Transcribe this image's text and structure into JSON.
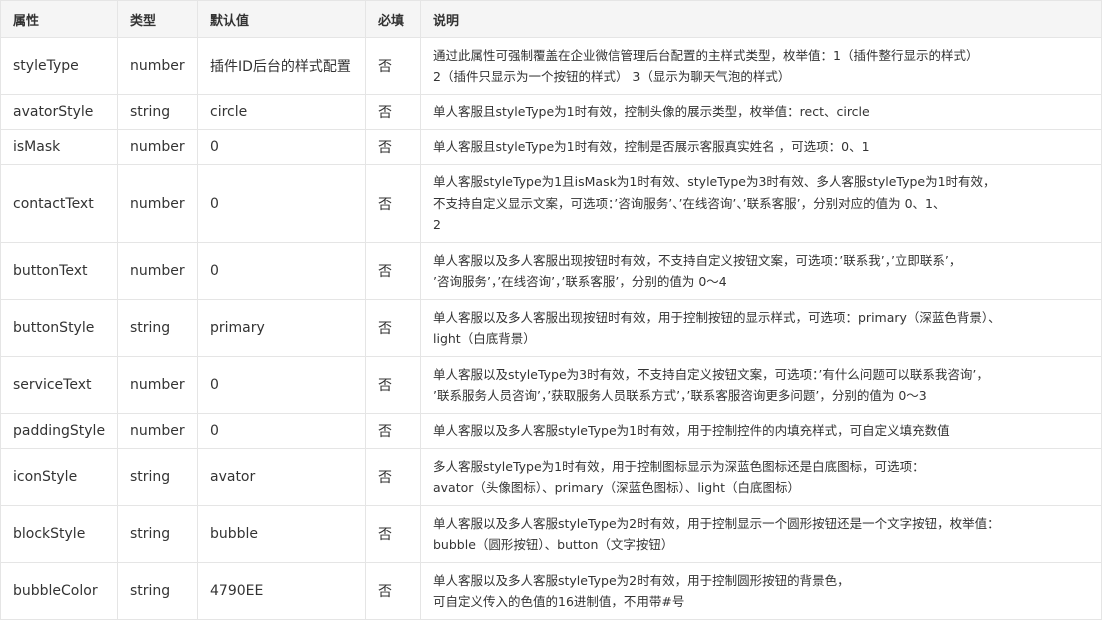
{
  "headers": {
    "attr": "属性",
    "type": "类型",
    "default": "默认值",
    "required": "必填",
    "desc": "说明"
  },
  "rows": [
    {
      "attr": "styleType",
      "type": "number",
      "default": "插件ID后台的样式配置",
      "required": "否",
      "desc": [
        "通过此属性可强制覆盖在企业微信管理后台配置的主样式类型，枚举值：1（插件整行显示的样式）",
        "2（插件只显示为一个按钮的样式）  3（显示为聊天气泡的样式）"
      ]
    },
    {
      "attr": "avatorStyle",
      "type": "string",
      "default": "circle",
      "required": "否",
      "desc": [
        "单人客服且styleType为1时有效，控制头像的展示类型，枚举值：rect、circle"
      ]
    },
    {
      "attr": "isMask",
      "type": "number",
      "default": "0",
      "required": "否",
      "desc": [
        "单人客服且styleType为1时有效，控制是否展示客服真实姓名 ，可选项：0、1"
      ]
    },
    {
      "attr": "contactText",
      "type": "number",
      "default": "0",
      "required": "否",
      "desc": [
        "单人客服styleType为1且isMask为1时有效、styleType为3时有效、多人客服styleType为1时有效，",
        "不支持自定义显示文案，可选项：’咨询服务’、’在线咨询’、’联系客服’，分别对应的值为 0、1、",
        "2"
      ]
    },
    {
      "attr": "buttonText",
      "type": "number",
      "default": "0",
      "required": "否",
      "desc": [
        "单人客服以及多人客服出现按钮时有效，不支持自定义按钮文案，可选项：’联系我’，’立即联系’，",
        "’咨询服务’，’在线咨询’，’联系客服’，分别的值为 0～4"
      ]
    },
    {
      "attr": "buttonStyle",
      "type": "string",
      "default": "primary",
      "required": "否",
      "desc": [
        "单人客服以及多人客服出现按钮时有效，用于控制按钮的显示样式，可选项：primary（深蓝色背景）、",
        "light（白底背景）"
      ]
    },
    {
      "attr": "serviceText",
      "type": "number",
      "default": "0",
      "required": "否",
      "desc": [
        "单人客服以及styleType为3时有效，不支持自定义按钮文案，可选项：’有什么问题可以联系我咨询’，",
        "’联系服务人员咨询’，’获取服务人员联系方式’，’联系客服咨询更多问题’，分别的值为 0～3"
      ]
    },
    {
      "attr": "paddingStyle",
      "type": "number",
      "default": "0",
      "required": "否",
      "desc": [
        "单人客服以及多人客服styleType为1时有效，用于控制控件的内填充样式，可自定义填充数值"
      ]
    },
    {
      "attr": "iconStyle",
      "type": "string",
      "default": "avator",
      "required": "否",
      "desc": [
        "多人客服styleType为1时有效，用于控制图标显示为深蓝色图标还是白底图标，可选项：",
        "avator（头像图标）、primary（深蓝色图标）、light（白底图标）"
      ]
    },
    {
      "attr": "blockStyle",
      "type": "string",
      "default": "bubble",
      "required": "否",
      "desc": [
        "单人客服以及多人客服styleType为2时有效，用于控制显示一个圆形按钮还是一个文字按钮，枚举值：",
        "bubble（圆形按钮）、button（文字按钮）"
      ]
    },
    {
      "attr": "bubbleColor",
      "type": "string",
      "default": "4790EE",
      "required": "否",
      "desc": [
        "单人客服以及多人客服styleType为2时有效，用于控制圆形按钮的背景色，",
        "可自定义传入的色值的16进制值，不用带#号"
      ]
    }
  ]
}
